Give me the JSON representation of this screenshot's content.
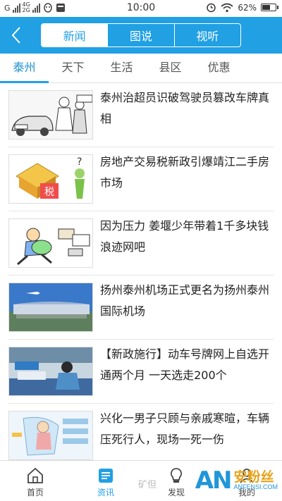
{
  "status_bar": {
    "left_signal_label": "G",
    "network_top": "4G",
    "network_bottom": "2G",
    "time": "10:00",
    "battery_text": "62%",
    "battery_level": 0.62,
    "icons": [
      "qq-icon",
      "message-icon",
      "alarm-icon",
      "wifi-icon"
    ]
  },
  "header": {
    "back_icon": "chevron-left-icon",
    "tabs": [
      {
        "label": "新闻",
        "active": true
      },
      {
        "label": "图说",
        "active": false
      },
      {
        "label": "视听",
        "active": false
      }
    ]
  },
  "subtabs": [
    {
      "label": "泰州",
      "active": true
    },
    {
      "label": "天下",
      "active": false
    },
    {
      "label": "生活",
      "active": false
    },
    {
      "label": "县区",
      "active": false
    },
    {
      "label": "优惠",
      "active": false
    }
  ],
  "news": [
    {
      "title": "泰州治超员识破驾驶员篡改车牌真相",
      "thumb": "cartoon-police-car"
    },
    {
      "title": "房地产交易税新政引爆靖江二手房市场",
      "thumb": "cartoon-house-tax"
    },
    {
      "title": "因为压力 姜堰少年带着1千多块钱浪迹网吧",
      "thumb": "cartoon-running-boy"
    },
    {
      "title": "扬州泰州机场正式更名为扬州泰州国际机场",
      "thumb": "airport-photo"
    },
    {
      "title": "【新政施行】动车号牌网上自选开通两个月 一天选走200个",
      "thumb": "office-photo"
    },
    {
      "title": "兴化一男子只顾与亲戚寒暄，车辆压死行人，现场一死一伤",
      "thumb": "accident-diagram"
    }
  ],
  "bottom_nav": [
    {
      "label": "首页",
      "icon": "home-icon",
      "active": false
    },
    {
      "label": "资讯",
      "icon": "news-icon",
      "active": true
    },
    {
      "label": "发现",
      "icon": "bulb-icon",
      "active": false
    },
    {
      "label": "我的",
      "icon": "user-icon",
      "active": false
    }
  ],
  "overlay": {
    "faded_text": "矿但",
    "watermark_logo": "AN",
    "watermark_cn": "安粉丝",
    "watermark_en": "ANFENSI.COM"
  },
  "colors": {
    "accent": "#21a0e3",
    "watermark_orange": "#e8a21a"
  }
}
